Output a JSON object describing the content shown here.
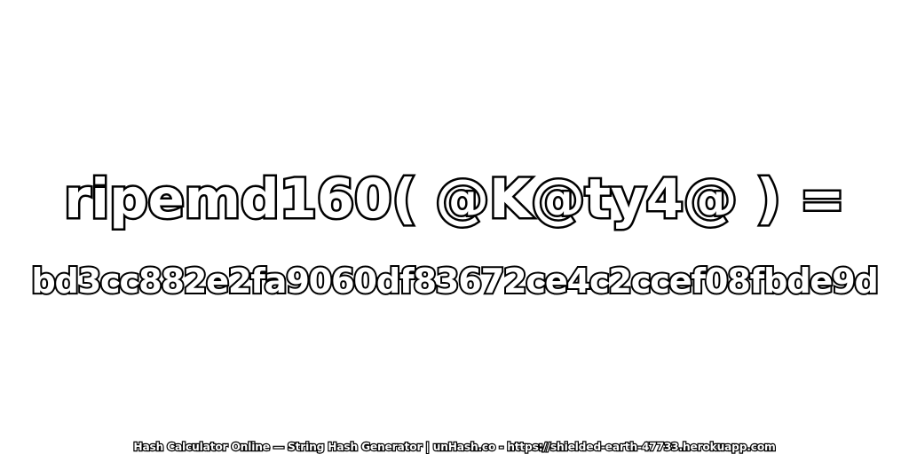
{
  "headline": "ripemd160( @K@ty4@ ) =",
  "hash_value": "bd3cc882e2fa9060df83672ce4c2ccef08fbde9d",
  "footer": "Hash Calculator Online — String Hash Generator | unHash.co - https://shielded-earth-47733.herokuapp.com",
  "colors": {
    "background": "#ffffff",
    "text_fill": "#ffffff",
    "text_outline": "#000000"
  }
}
